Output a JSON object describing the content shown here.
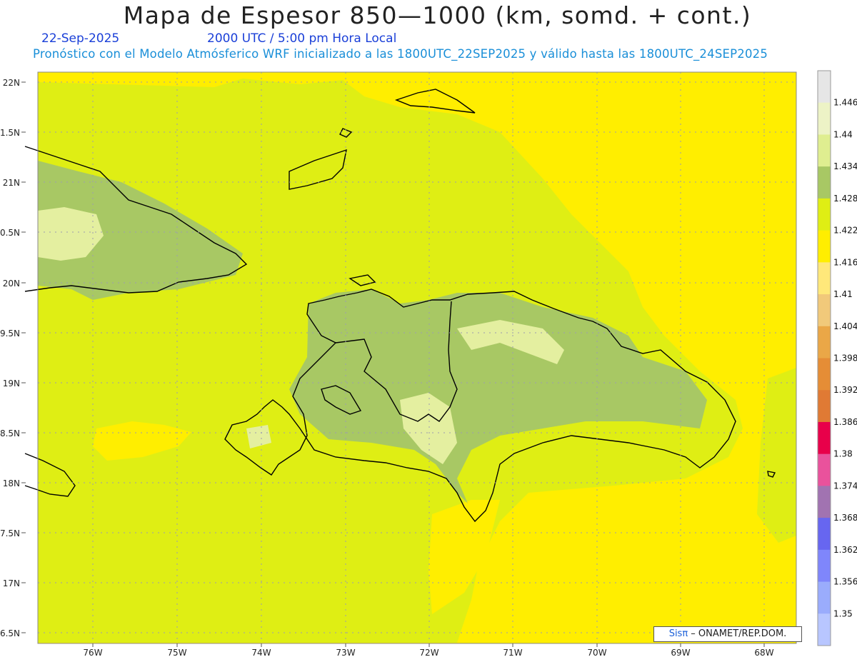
{
  "title": "Mapa de Espesor 850—1000 (km, somd. + cont.)",
  "date": "22-Sep-2025",
  "time": "2000 UTC / 5:00 pm Hora Local",
  "info": "Pronóstico con el Modelo Atmósferico WRF inicializado a las 1800UTC_22SEP2025 y válido hasta las  1800UTC_24SEP2025",
  "lat_labels": [
    "22N",
    "1.5N",
    "21N",
    "0.5N",
    "20N",
    "9.5N",
    "19N",
    "8.5N",
    "18N",
    "7.5N",
    "17N",
    "6.5N"
  ],
  "lon_labels": [
    "76W",
    "75W",
    "74W",
    "73W",
    "72W",
    "71W",
    "70W",
    "69W",
    "68W"
  ],
  "colorbar": {
    "labels": [
      "1.446",
      "1.44",
      "1.434",
      "1.428",
      "1.422",
      "1.416",
      "1.41",
      "1.404",
      "1.398",
      "1.392",
      "1.386",
      "1.38",
      "1.374",
      "1.368",
      "1.362",
      "1.356",
      "1.35"
    ],
    "colors": [
      "#e6e6e6",
      "#edf3c6",
      "#dfee90",
      "#a8c864",
      "#dfee14",
      "#ffee00",
      "#ffe87a",
      "#f1c97a",
      "#eaa747",
      "#e58d36",
      "#e07a34",
      "#e8004a",
      "#e9529c",
      "#a173b1",
      "#6766f0",
      "#7f86fb",
      "#9aacfc",
      "#b8c6ff"
    ]
  },
  "credit": {
    "brand": "Sisπ",
    "text": " – ONAMET/REP.DOM."
  },
  "colors": {
    "sea_yellow": "#ffee00",
    "light_green": "#dfee14",
    "mid_green": "#a8c864",
    "pale": "#e4efa0",
    "coast": "#000000"
  }
}
